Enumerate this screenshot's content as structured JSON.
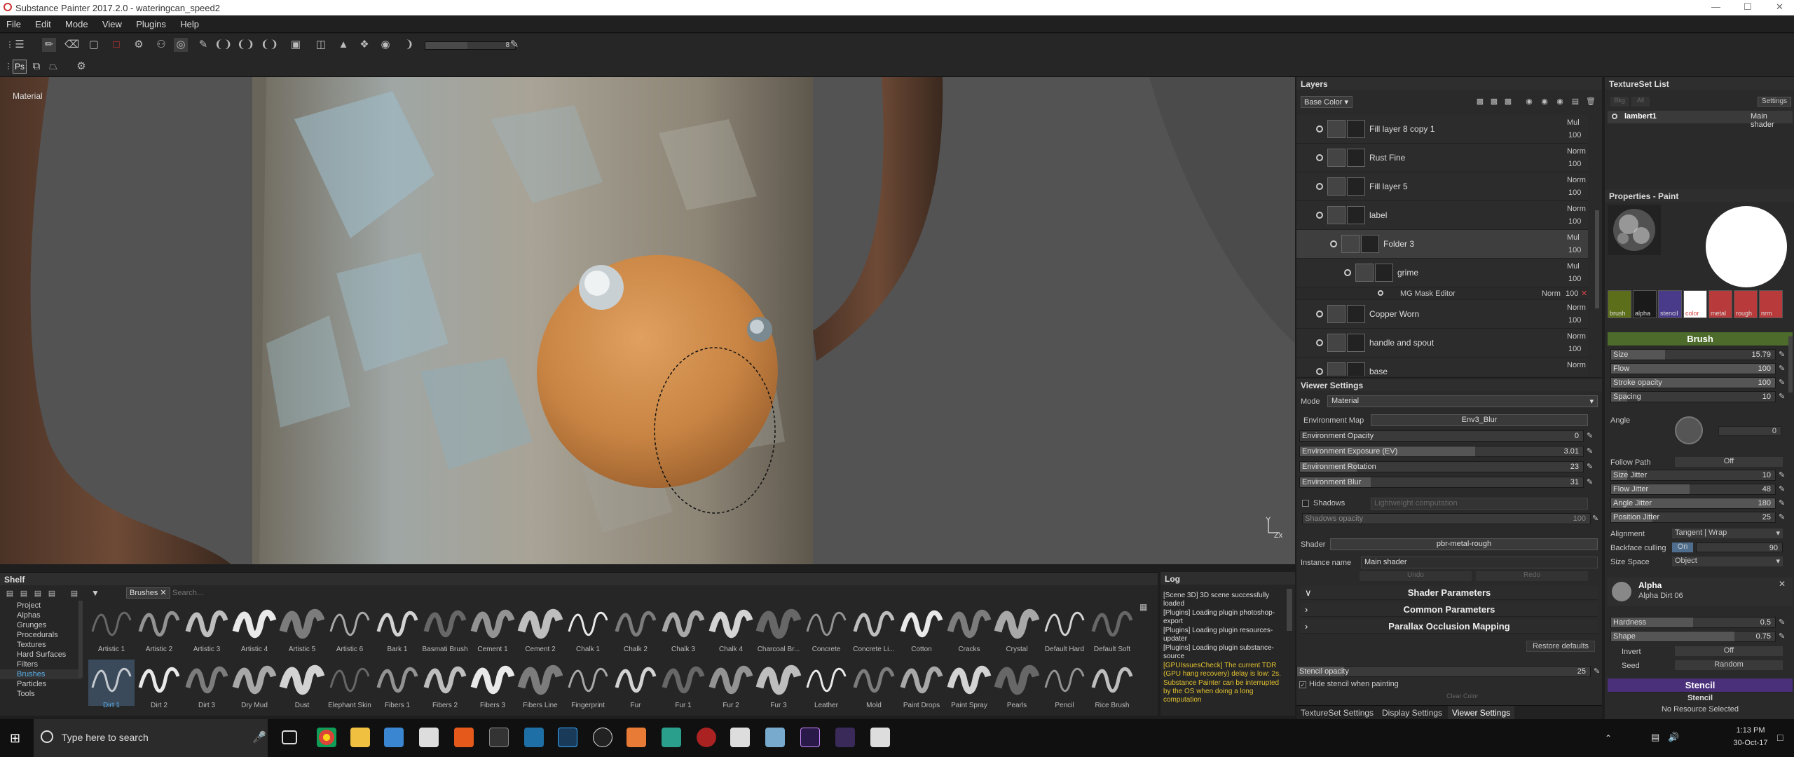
{
  "window": {
    "title": "Substance Painter 2017.2.0 - wateringcan_speed2",
    "minimize": "—",
    "maximize": "☐",
    "close": "✕"
  },
  "menu": [
    "File",
    "Edit",
    "Mode",
    "View",
    "Plugins",
    "Help"
  ],
  "toolbar": {
    "brush_size": "8",
    "ps_label": "Ps"
  },
  "viewport": {
    "mode_label": "Material",
    "axis_y": "Y",
    "axis_zx": "Zx"
  },
  "layers": {
    "title": "Layers",
    "channel": "Base Color",
    "items": [
      {
        "name": "Fill layer 8 copy 1",
        "blend": "Mul",
        "opacity": "100"
      },
      {
        "name": "Rust Fine",
        "blend": "Norm",
        "opacity": "100"
      },
      {
        "name": "Fill layer 5",
        "blend": "Norm",
        "opacity": "100"
      },
      {
        "name": "label",
        "blend": "Norm",
        "opacity": "100"
      },
      {
        "name": "Folder 3",
        "blend": "Mul",
        "opacity": "100"
      },
      {
        "name": "grime",
        "blend": "Mul",
        "opacity": "100"
      },
      {
        "name": "Copper Worn",
        "blend": "Norm",
        "opacity": "100"
      },
      {
        "name": "handle and spout",
        "blend": "Norm",
        "opacity": "100"
      },
      {
        "name": "base",
        "blend": "Norm",
        "opacity": ""
      }
    ],
    "mask_editor": {
      "name": "MG Mask Editor",
      "blend": "Norm",
      "opacity": "100"
    }
  },
  "viewer": {
    "title": "Viewer Settings",
    "mode_label": "Mode",
    "mode_value": "Material",
    "envmap_label": "Environment Map",
    "envmap_value": "Env3_Blur",
    "sliders": [
      {
        "label": "Environment Opacity",
        "value": "0"
      },
      {
        "label": "Environment Exposure (EV)",
        "value": "3.01"
      },
      {
        "label": "Environment Rotation",
        "value": "23"
      },
      {
        "label": "Environment Blur",
        "value": "31"
      }
    ],
    "shadows_label": "Shadows",
    "shadows_value": "Lightweight computation",
    "shadows_opacity_label": "Shadows opacity",
    "shadows_opacity_value": "100",
    "shader_label": "Shader",
    "shader_value": "pbr-metal-rough",
    "instance_label": "Instance name",
    "instance_value": "Main shader",
    "undo": "Undo",
    "redo": "Redo",
    "shader_params": "Shader Parameters",
    "common_params": "Common Parameters",
    "parallax": "Parallax Occlusion Mapping",
    "restore": "Restore defaults",
    "stencil_opacity_label": "Stencil opacity",
    "stencil_opacity_value": "25",
    "hide_stencil": "Hide stencil when painting",
    "clear_color": "Clear Color",
    "tabs": [
      "TextureSet Settings",
      "Display Settings",
      "Viewer Settings"
    ]
  },
  "texset": {
    "title": "TextureSet List",
    "btn1": "Bkg",
    "btn2": "All",
    "settings": "Settings",
    "item": "lambert1",
    "shader": "Main shader"
  },
  "props": {
    "title": "Properties - Paint",
    "slots": [
      "brush",
      "alpha",
      "stencil",
      "color",
      "metal",
      "rough",
      "nrm"
    ],
    "brush_header": "Brush",
    "sliders": [
      {
        "label": "Size",
        "value": "15.79"
      },
      {
        "label": "Flow",
        "value": "100"
      },
      {
        "label": "Stroke opacity",
        "value": "100"
      },
      {
        "label": "Spacing",
        "value": "10"
      }
    ],
    "angle_label": "Angle",
    "angle_value": "0",
    "follow_path_label": "Follow Path",
    "follow_path_value": "Off",
    "jitter": [
      {
        "label": "Size Jitter",
        "value": "10"
      },
      {
        "label": "Flow Jitter",
        "value": "48"
      },
      {
        "label": "Angle Jitter",
        "value": "180"
      },
      {
        "label": "Position Jitter",
        "value": "25"
      }
    ],
    "alignment_label": "Alignment",
    "alignment_value": "Tangent | Wrap",
    "backface_label": "Backface culling",
    "backface_toggle": "On",
    "backface_value": "90",
    "sizespace_label": "Size Space",
    "sizespace_value": "Object",
    "alpha_title": "Alpha",
    "alpha_name": "Alpha Dirt 06",
    "alpha_sliders": [
      {
        "label": "Hardness",
        "value": "0.5"
      },
      {
        "label": "Shape",
        "value": "0.75"
      }
    ],
    "invert_label": "Invert",
    "invert_value": "Off",
    "seed_label": "Seed",
    "seed_value": "Random",
    "stencil_header": "Stencil",
    "stencil_sub": "Stencil",
    "stencil_none": "No Resource Selected"
  },
  "shelf": {
    "title": "Shelf",
    "tab": "Brushes",
    "search_placeholder": "Search...",
    "categories": [
      "Project",
      "Alphas",
      "Grunges",
      "Procedurals",
      "Textures",
      "Hard Surfaces",
      "Filters",
      "Brushes",
      "Particles",
      "Tools"
    ],
    "row1": [
      "Artistic 1",
      "Artistic 2",
      "Artistic 3",
      "Artistic 4",
      "Artistic 5",
      "Artistic 6",
      "Bark 1",
      "Basmati Brush",
      "Cement 1",
      "Cement 2",
      "Chalk 1",
      "Chalk 2",
      "Chalk 3",
      "Chalk 4",
      "Charcoal Br...",
      "Concrete",
      "Concrete Li...",
      "Cotton",
      "Cracks",
      "Crystal",
      "Default Hard",
      "Default Soft"
    ],
    "row2": [
      "Dirt 1",
      "Dirt 2",
      "Dirt 3",
      "Dry Mud",
      "Dust",
      "Elephant Skin",
      "Fibers 1",
      "Fibers 2",
      "Fibers 3",
      "Fibers Line",
      "Fingerprint",
      "Fur",
      "Fur 1",
      "Fur 2",
      "Fur 3",
      "Leather",
      "Mold",
      "Paint Drops",
      "Paint Spray",
      "Pearls",
      "Pencil",
      "Rice Brush"
    ]
  },
  "log": {
    "title": "Log",
    "lines": [
      {
        "text": "[Scene 3D] 3D scene successfully loaded",
        "color": "#dddddd"
      },
      {
        "text": "[Plugins] Loading plugin photoshop-export",
        "color": "#dddddd"
      },
      {
        "text": "[Plugins] Loading plugin resources-updater",
        "color": "#dddddd"
      },
      {
        "text": "[Plugins] Loading plugin substance-source",
        "color": "#dddddd"
      },
      {
        "text": "[GPUIssuesCheck] The current TDR (GPU hang recovery) delay is low: 2s.",
        "color": "#e0c030"
      },
      {
        "text": "Substance Painter can be interrupted by the OS when doing a long computation",
        "color": "#e0c030"
      }
    ]
  },
  "taskbar": {
    "search": "Type here to search",
    "time": "1:13 PM",
    "date": "30-Oct-17"
  }
}
